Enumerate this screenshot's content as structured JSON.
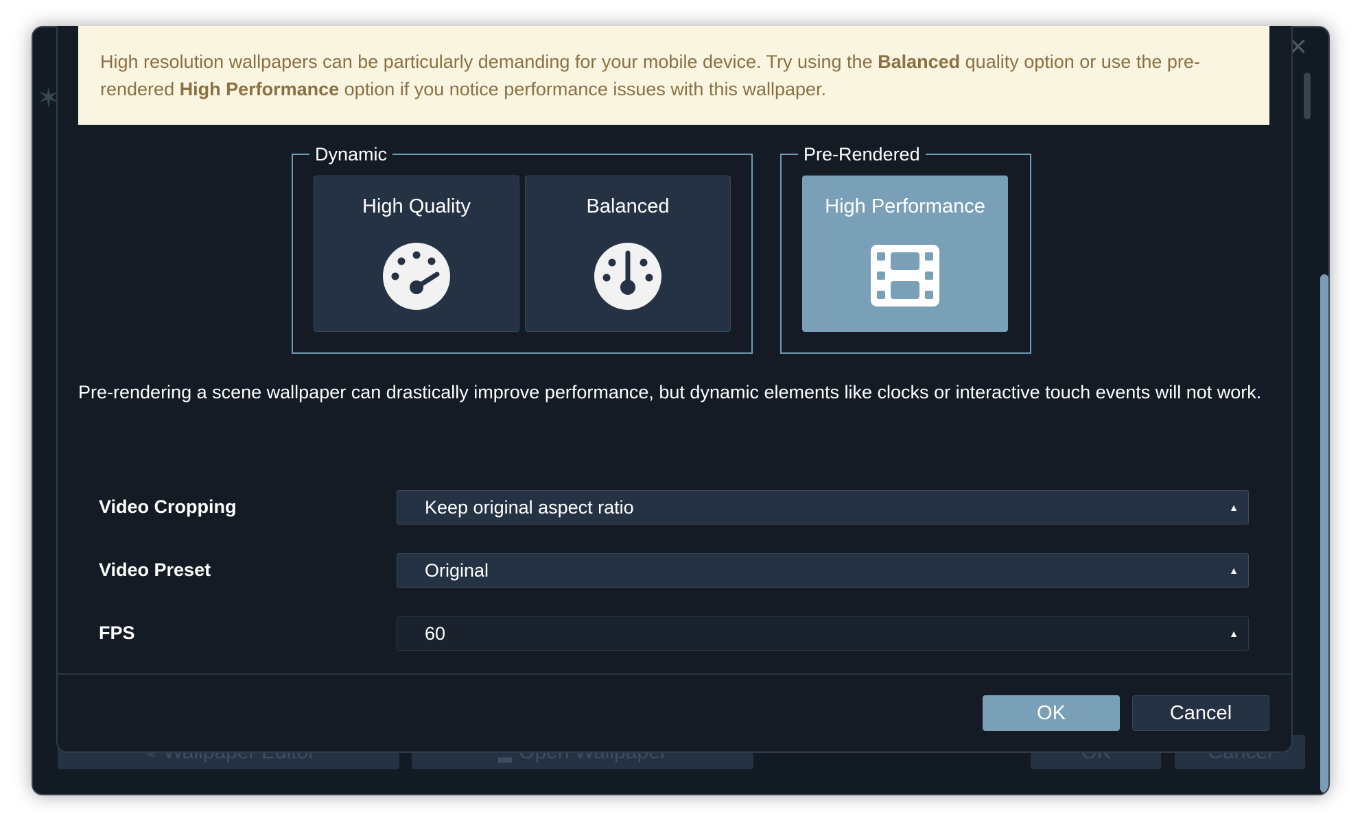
{
  "warning": {
    "part1": "High resolution wallpapers can be particularly demanding for your mobile device. Try using the ",
    "bold1": "Balanced",
    "part2": " quality option or use the pre-rendered ",
    "bold2": "High Performance",
    "part3": " option if you notice performance issues with this wallpaper."
  },
  "groups": {
    "dynamic": {
      "legend": "Dynamic",
      "options": [
        {
          "label": "High Quality",
          "icon": "gauge-high-icon"
        },
        {
          "label": "Balanced",
          "icon": "gauge-balanced-icon"
        }
      ]
    },
    "prerendered": {
      "legend": "Pre-Rendered",
      "options": [
        {
          "label": "High Performance",
          "icon": "film-icon",
          "selected": true
        }
      ]
    }
  },
  "description": "Pre-rendering a scene wallpaper can drastically improve performance, but dynamic elements like clocks or interactive touch events will not work.",
  "settings": [
    {
      "label": "Video Cropping",
      "value": "Keep original aspect ratio"
    },
    {
      "label": "Video Preset",
      "value": "Original"
    },
    {
      "label": "FPS",
      "value": "60"
    }
  ],
  "buttons": {
    "ok": "OK",
    "cancel": "Cancel"
  },
  "background_window": {
    "footer_buttons": [
      "Wallpaper Editor",
      "Open Wallpaper",
      "OK",
      "Cancel"
    ]
  },
  "colors": {
    "accent": "#7aa0b7",
    "dialog_bg": "#151b25",
    "option_bg": "#243244",
    "warning_bg": "#faf5e1",
    "warning_text": "#8a7042"
  }
}
